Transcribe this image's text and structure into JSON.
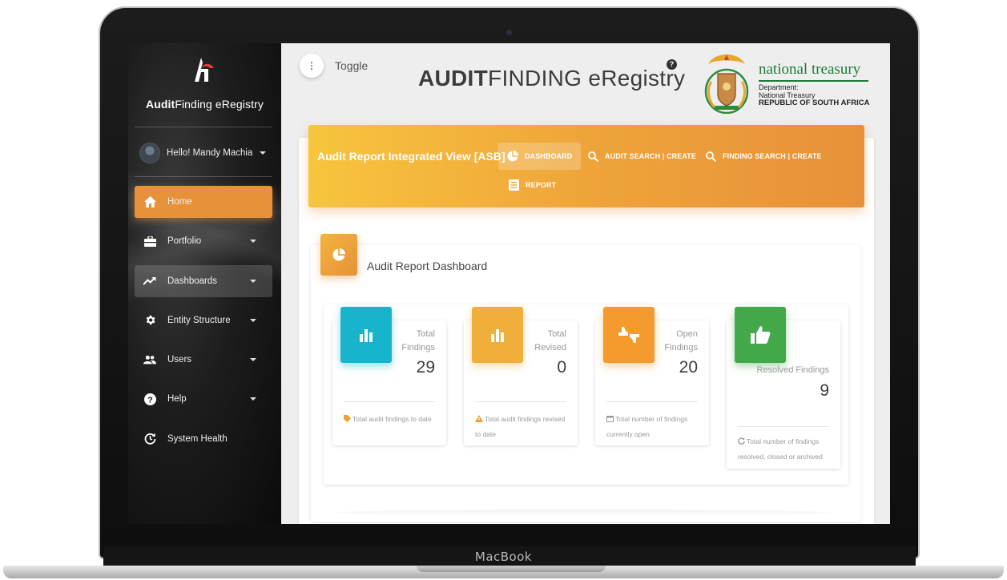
{
  "device": {
    "label": "MacBook"
  },
  "sidebar": {
    "brand_bold": "Audit",
    "brand_rest": "Finding eRegistry",
    "user_greeting": "Hello! Mandy Machia",
    "items": [
      {
        "label": "Home",
        "icon": "home-icon",
        "state": "active"
      },
      {
        "label": "Portfolio",
        "icon": "briefcase-icon",
        "has_submenu": true
      },
      {
        "label": "Dashboards",
        "icon": "trending-up-icon",
        "has_submenu": true,
        "state": "hover"
      },
      {
        "label": "Entity Structure",
        "icon": "gear-icon",
        "has_submenu": true
      },
      {
        "label": "Users",
        "icon": "users-icon",
        "has_submenu": true
      },
      {
        "label": "Help",
        "icon": "help-icon",
        "has_submenu": true
      },
      {
        "label": "System Health",
        "icon": "refresh-icon"
      }
    ]
  },
  "header": {
    "toggle_label": "Toggle",
    "title_bold": "AUDIT",
    "title_rest": "FINDING eRegistry",
    "help_badge": "?",
    "org_name": "national treasury",
    "org_line1": "Department:",
    "org_line2": "National Treasury",
    "org_line3": "REPUBLIC OF SOUTH AFRICA"
  },
  "banner": {
    "title": "Audit Report Integrated View [ASB] :",
    "tabs": [
      {
        "label": "DASHBOARD",
        "icon": "pie-chart-icon",
        "active": true
      },
      {
        "label": "AUDIT SEARCH | CREATE",
        "icon": "search-icon"
      },
      {
        "label": "FINDING SEARCH | CREATE",
        "icon": "search-icon"
      },
      {
        "label": "REPORT",
        "icon": "document-icon"
      }
    ]
  },
  "dashboard": {
    "title": "Audit Report Dashboard",
    "stats": [
      {
        "label": "Total Findings",
        "value": "29",
        "footer": "Total audit findings to date",
        "icon": "bar-chart-icon",
        "color": "#18b4cc",
        "footer_icon": "tag-icon"
      },
      {
        "label": "Total Revised",
        "value": "0",
        "footer": "Total audit findings revised to date",
        "icon": "bar-chart-icon",
        "color": "#f0ae3a",
        "footer_icon": "warning-icon"
      },
      {
        "label": "Open Findings",
        "value": "20",
        "footer": "Total number of findings currently open",
        "icon": "thumbs-icon",
        "color": "#f59a2c",
        "footer_icon": "calendar-icon"
      },
      {
        "label": "Resolved Findings",
        "value": "9",
        "footer": "Total number of findings resolved, closed or archived",
        "icon": "thumbs-up-icon",
        "color": "#43a84a",
        "footer_icon": "refresh-icon"
      }
    ]
  },
  "colors": {
    "accent": "#e7913a",
    "banner_start": "#f7c53e",
    "brand_green": "#1c7a3a"
  }
}
